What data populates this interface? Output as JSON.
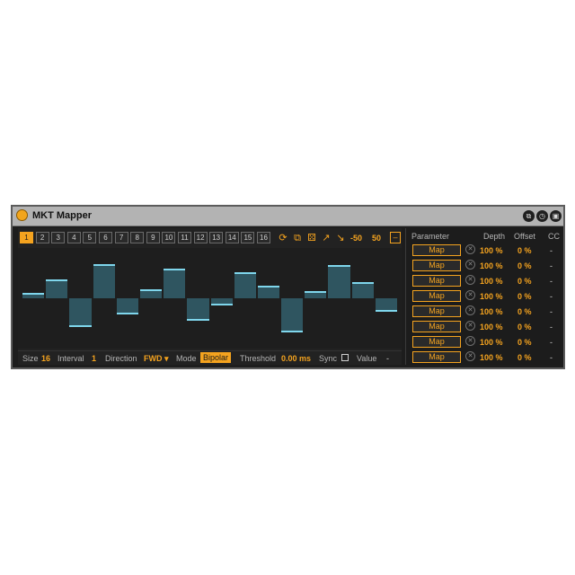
{
  "device": {
    "title": "MKT Mapper",
    "title_icons": [
      "window-icon",
      "clock-icon",
      "save-icon"
    ]
  },
  "steps": {
    "labels": [
      "1",
      "2",
      "3",
      "4",
      "5",
      "6",
      "7",
      "8",
      "9",
      "10",
      "11",
      "12",
      "13",
      "14",
      "15",
      "16"
    ],
    "active_index": 0
  },
  "toolbar": {
    "tools": [
      "loop-icon",
      "copy-icon",
      "random-dice-icon",
      "ramp-up-icon",
      "ramp-down-icon"
    ],
    "range_min": "-50",
    "range_max": "50",
    "collapse_label": "–"
  },
  "sequence": {
    "range": [
      -1,
      1
    ],
    "values": [
      0.1,
      0.38,
      -0.6,
      0.72,
      -0.32,
      0.17,
      0.62,
      -0.46,
      -0.14,
      0.53,
      0.25,
      -0.72,
      0.13,
      0.7,
      0.33,
      -0.27
    ]
  },
  "bottom": {
    "size_label": "Size",
    "size_value": "16",
    "interval_label": "Interval",
    "interval_value": "1",
    "direction_label": "Direction",
    "direction_value": "FWD ▾",
    "mode_label": "Mode",
    "mode_value": "Bipolar",
    "threshold_label": "Threshold",
    "threshold_value": "0.00 ms",
    "sync_label": "Sync",
    "value_label": "Value",
    "value_value": "-"
  },
  "mapping": {
    "headers": {
      "parameter": "Parameter",
      "depth": "Depth",
      "offset": "Offset",
      "cc": "CC"
    },
    "rows": [
      {
        "map": "Map",
        "depth": "100 %",
        "offset": "0 %",
        "cc": "-"
      },
      {
        "map": "Map",
        "depth": "100 %",
        "offset": "0 %",
        "cc": "-"
      },
      {
        "map": "Map",
        "depth": "100 %",
        "offset": "0 %",
        "cc": "-"
      },
      {
        "map": "Map",
        "depth": "100 %",
        "offset": "0 %",
        "cc": "-"
      },
      {
        "map": "Map",
        "depth": "100 %",
        "offset": "0 %",
        "cc": "-"
      },
      {
        "map": "Map",
        "depth": "100 %",
        "offset": "0 %",
        "cc": "-"
      },
      {
        "map": "Map",
        "depth": "100 %",
        "offset": "0 %",
        "cc": "-"
      },
      {
        "map": "Map",
        "depth": "100 %",
        "offset": "0 %",
        "cc": "-"
      }
    ]
  },
  "colors": {
    "accent": "#f4a31f",
    "bar_fill": "#2f5560",
    "bar_cap": "#7fd6ec",
    "panel": "#1d1d1d",
    "titlebar": "#b3b3b3"
  }
}
